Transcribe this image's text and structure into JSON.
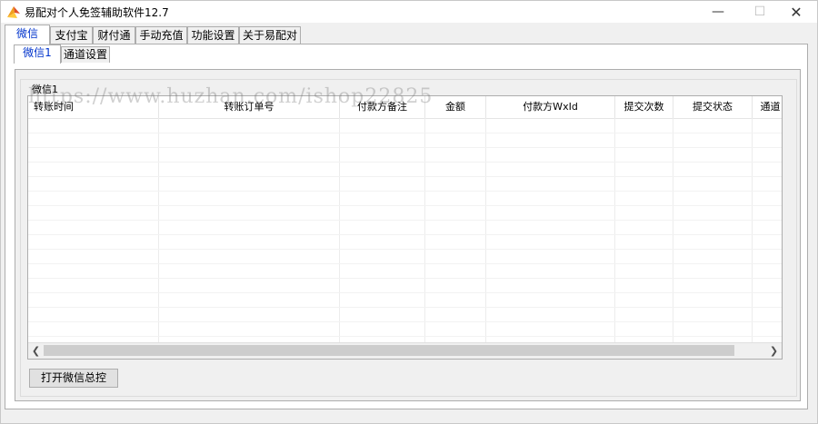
{
  "window": {
    "title": "易配对个人免签辅助软件12.7",
    "controls": {
      "minimize": "—",
      "maximize": "☐",
      "close": "✕"
    }
  },
  "main_tabs": [
    {
      "label": "微信",
      "active": true
    },
    {
      "label": "支付宝"
    },
    {
      "label": "财付通"
    },
    {
      "label": "手动充值"
    },
    {
      "label": "功能设置"
    },
    {
      "label": "关于易配对"
    }
  ],
  "inner_tabs": [
    {
      "label": "微信1",
      "active": true
    },
    {
      "label": "通道设置"
    }
  ],
  "group": {
    "label": "微信1"
  },
  "table": {
    "columns": [
      "转账时间",
      "转账订单号",
      "付款方备注",
      "金额",
      "付款方WxId",
      "提交次数",
      "提交状态",
      "通道"
    ],
    "rows": []
  },
  "buttons": {
    "open_monitor": "打开微信总控"
  },
  "watermark": "https://www.huzhan.com/ishop22825",
  "icons": {
    "app": "app-logo-icon",
    "scroll_left": "chevron-left-icon",
    "scroll_right": "chevron-right-icon"
  },
  "colors": {
    "active_tab_text": "#0033cc",
    "border": "#adadad",
    "app_icon": "#f0a020"
  }
}
